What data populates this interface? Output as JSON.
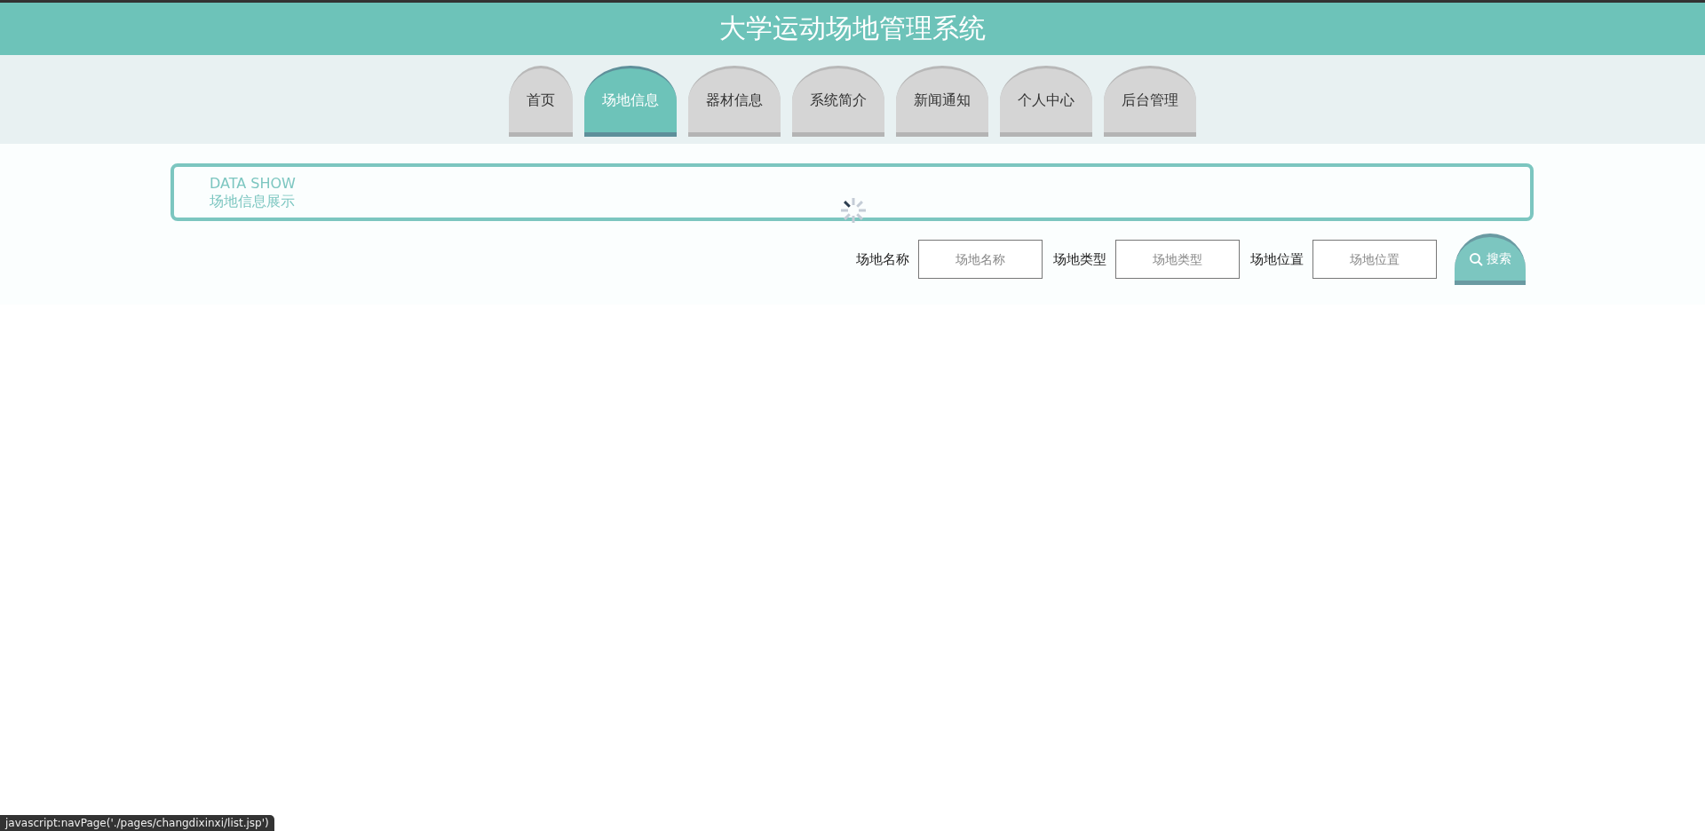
{
  "header": {
    "title": "大学运动场地管理系统"
  },
  "nav": [
    {
      "label": "首页",
      "selected": false
    },
    {
      "label": "场地信息",
      "selected": true
    },
    {
      "label": "器材信息",
      "selected": false
    },
    {
      "label": "系统简介",
      "selected": false
    },
    {
      "label": "新闻通知",
      "selected": false
    },
    {
      "label": "个人中心",
      "selected": false
    },
    {
      "label": "后台管理",
      "selected": false
    }
  ],
  "banner": {
    "title": "DATA SHOW",
    "subtitle": "场地信息展示"
  },
  "search": {
    "fields": [
      {
        "label": "场地名称",
        "placeholder": "场地名称"
      },
      {
        "label": "场地类型",
        "placeholder": "场地类型"
      },
      {
        "label": "场地位置",
        "placeholder": "场地位置"
      }
    ],
    "button": "搜索"
  },
  "status_bar": {
    "text": "javascript:navPage('./pages/changdixinxi/list.jsp')"
  }
}
